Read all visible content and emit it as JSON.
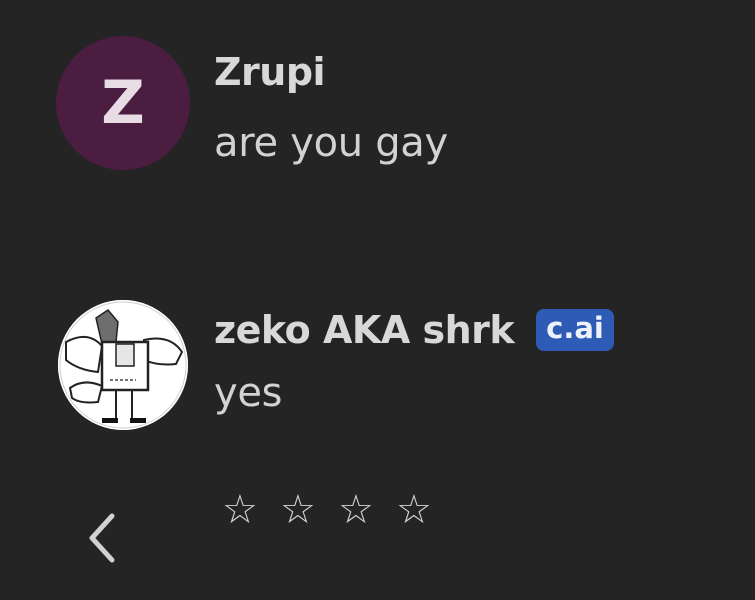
{
  "messages": [
    {
      "author": "Zrupi",
      "avatar_letter": "Z",
      "avatar_color": "#4b1d40",
      "text": "are you gay"
    },
    {
      "author": "zeko AKA shrk",
      "badge": "c.ai",
      "badge_color": "#2d5bb5",
      "avatar_icon": "sketch-character-avatar",
      "text": "yes"
    }
  ],
  "controls": {
    "back_icon": "chevron-left-icon",
    "stars": [
      "☆",
      "☆",
      "☆",
      "☆"
    ]
  }
}
